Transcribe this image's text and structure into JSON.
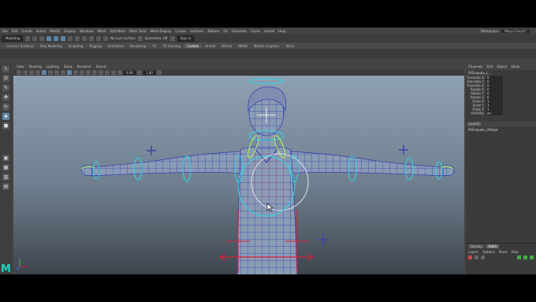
{
  "menubar": {
    "items": [
      "File",
      "Edit",
      "Create",
      "Select",
      "Modify",
      "Display",
      "Windows",
      "Mesh",
      "Edit Mesh",
      "Mesh Tools",
      "Mesh Display",
      "Curves",
      "Surfaces",
      "Deform",
      "UV",
      "Generate",
      "Cache",
      "Arnold",
      "Help"
    ],
    "workspace_label": "Workspace:",
    "workspace_value": "Maya Classic*"
  },
  "status": {
    "mode": "Modeling",
    "live_surface": "No Live Surface",
    "symmetry": "Symmetry: Off",
    "sign_in": "Sign In"
  },
  "shelf_tabs": [
    "Curves / Surfaces",
    "Poly Modeling",
    "Sculpting",
    "Rigging",
    "Animation",
    "Rendering",
    "FX",
    "FX Caching",
    "Custom",
    "Arnold",
    "Bifrost",
    "MASH",
    "Motion Graphics",
    "XGen"
  ],
  "shelf_active": "Custom",
  "viewport": {
    "menus": [
      "View",
      "Shading",
      "Lighting",
      "Show",
      "Renderer",
      "Panels"
    ],
    "field1": "0.00",
    "field2": "1.00"
  },
  "channel_box": {
    "tabs": [
      "Channels",
      "Edit",
      "Object",
      "Show"
    ],
    "object_name": "FKScapula_L...",
    "attributes": [
      {
        "name": "Translate X",
        "value": "0"
      },
      {
        "name": "Translate Y",
        "value": "0"
      },
      {
        "name": "Translate Z",
        "value": "0"
      },
      {
        "name": "Rotate X",
        "value": "0"
      },
      {
        "name": "Rotate Y",
        "value": "0"
      },
      {
        "name": "Rotate Z",
        "value": "0"
      },
      {
        "name": "Scale X",
        "value": "1"
      },
      {
        "name": "Scale Y",
        "value": "1"
      },
      {
        "name": "Scale Z",
        "value": "1"
      },
      {
        "name": "Visibility",
        "value": "on"
      }
    ],
    "shapes_header": "SHAPES",
    "shape_name": "FKScapula_LShape"
  },
  "layers": {
    "tabs": [
      "Display",
      "Anim"
    ],
    "active_tab": "Anim",
    "menus": [
      "Layers",
      "Options",
      "Show",
      "Help"
    ]
  },
  "logo_letter": "M",
  "colors": {
    "viewport_top": "#8ea1b3",
    "viewport_bottom": "#3e454d",
    "wire_blue": "#3b42ad",
    "control_cyan": "#2fd6e6",
    "control_green": "#a8f060",
    "rig_red": "#d8203a",
    "selection": "#5e84a8",
    "logo": "#1dd3c2"
  }
}
